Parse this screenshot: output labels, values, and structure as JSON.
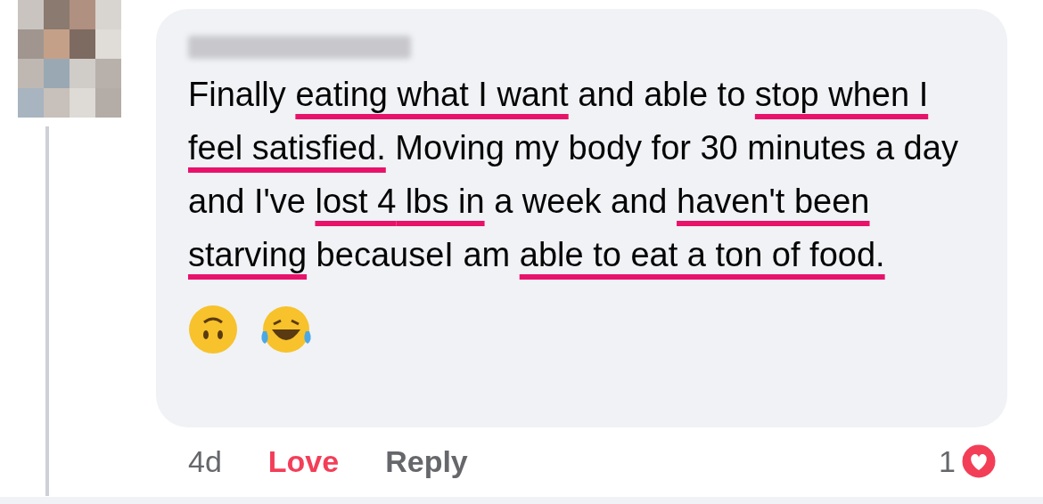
{
  "comment": {
    "segments": [
      {
        "text": "Finally ",
        "underlined": false
      },
      {
        "text": "eating what I want",
        "underlined": true
      },
      {
        "text": " and able to ",
        "underlined": false
      },
      {
        "text": "stop when I feel satisfied.",
        "underlined": true
      },
      {
        "text": " Moving my body for 30 minutes a day and I've ",
        "underlined": false
      },
      {
        "text": "lost 4",
        "underlined": true
      },
      {
        "text": " lbs in",
        "underlined": true
      },
      {
        "text": " a week and ",
        "underlined": false
      },
      {
        "text": "haven't been starving",
        "underlined": true
      },
      {
        "text": " becauseI am ",
        "underlined": false
      },
      {
        "text": "able to eat a ton of food.",
        "underlined": true
      }
    ]
  },
  "footer": {
    "time": "4d",
    "love": {
      "label": "Love",
      "selected": true
    },
    "reply": "Reply",
    "reaction_count": "1"
  }
}
